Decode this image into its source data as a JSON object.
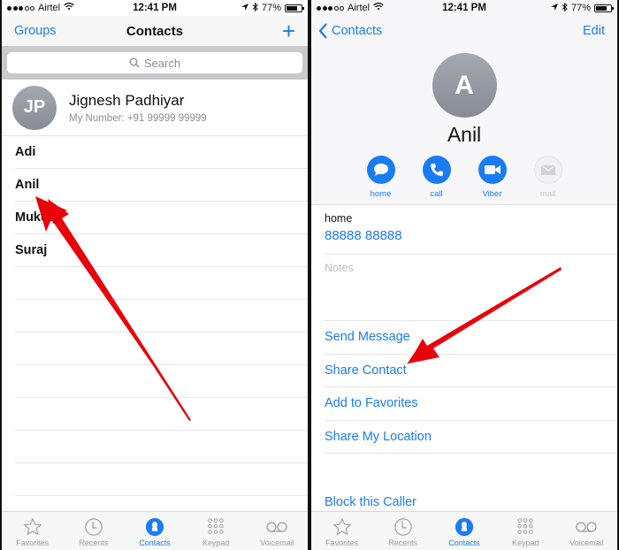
{
  "status_bar": {
    "carrier": "Airtel",
    "time": "12:41 PM",
    "battery": "77%",
    "battery_level": 0.77,
    "signal_bars_filled": 3,
    "signal_bars_total": 5
  },
  "left": {
    "nav": {
      "left_button": "Groups",
      "title": "Contacts",
      "add_icon": "plus-icon"
    },
    "search": {
      "placeholder": "Search"
    },
    "my_card": {
      "initials": "JP",
      "name": "Jignesh Padhiyar",
      "number": "My Number:  +91 99999 99999"
    },
    "contacts": [
      "Adi",
      "Anil",
      "Mukesh",
      "Suraj"
    ]
  },
  "right": {
    "nav": {
      "back_label": "Contacts",
      "edit_label": "Edit"
    },
    "contact": {
      "initial": "A",
      "name": "Anil"
    },
    "actions": [
      {
        "label": "home",
        "icon": "message-icon",
        "enabled": true
      },
      {
        "label": "call",
        "icon": "phone-icon",
        "enabled": true
      },
      {
        "label": "Viber",
        "icon": "video-icon",
        "enabled": true
      },
      {
        "label": "mail",
        "icon": "mail-icon",
        "enabled": false
      }
    ],
    "phone": {
      "label": "home",
      "number": "88888 88888"
    },
    "notes_label": "Notes",
    "action_rows": [
      "Send Message",
      "Share Contact",
      "Add to Favorites",
      "Share My Location"
    ],
    "block_label": "Block this Caller"
  },
  "tab_bar": {
    "tabs": [
      {
        "label": "Favorites",
        "icon": "star-icon"
      },
      {
        "label": "Recents",
        "icon": "clock-icon"
      },
      {
        "label": "Contacts",
        "icon": "person-icon",
        "active": true
      },
      {
        "label": "Keypad",
        "icon": "keypad-icon"
      },
      {
        "label": "Voicemail",
        "icon": "voicemail-icon"
      }
    ]
  },
  "colors": {
    "accent": "#1a7cf5",
    "annotation_arrow": "#e8000b"
  }
}
